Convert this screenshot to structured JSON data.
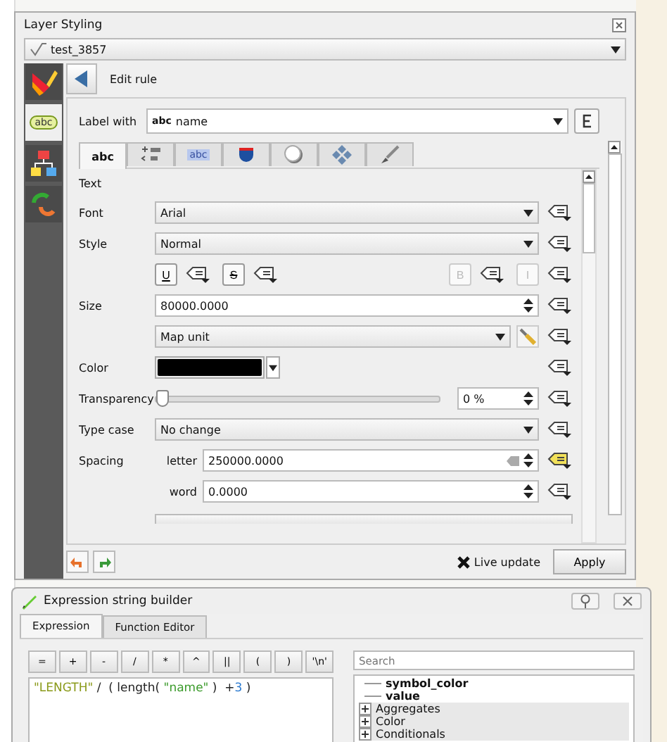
{
  "layer_styling": {
    "title": "Layer Styling",
    "layer": "test_3857",
    "edit_rule": "Edit rule",
    "sidebar": [
      {
        "kind": "brush",
        "selected": false
      },
      {
        "kind": "label",
        "text": "abc",
        "selected": true
      },
      {
        "kind": "diagram",
        "selected": false
      },
      {
        "kind": "history",
        "selected": false
      }
    ],
    "label_with": {
      "label": "Label with",
      "badge": "abc",
      "value": "name"
    },
    "tabs": [
      {
        "kind": "text",
        "text": "abc",
        "selected": true
      },
      {
        "kind": "formatting",
        "selected": false
      },
      {
        "kind": "buffer",
        "text": "abc",
        "selected": false
      },
      {
        "kind": "background",
        "selected": false
      },
      {
        "kind": "shadow",
        "selected": false
      },
      {
        "kind": "placement",
        "selected": false
      },
      {
        "kind": "rendering",
        "selected": false
      }
    ],
    "section": "Text",
    "rows": [
      {
        "kind": "combo",
        "label": "Font",
        "value": "Arial",
        "override_active": false
      },
      {
        "kind": "combo",
        "label": "Style",
        "value": "Normal",
        "override_active": false
      },
      {
        "kind": "toggles",
        "buttons": [
          {
            "text": "U",
            "override_active": false,
            "disabled": false
          },
          {
            "text": "S",
            "override_active": false,
            "disabled": false
          },
          {
            "text": "B",
            "override_active": false,
            "disabled": true
          },
          {
            "text": "I",
            "override_active": false,
            "disabled": true
          }
        ]
      },
      {
        "kind": "spin",
        "label": "Size",
        "value": "80000.0000",
        "override_active": false
      },
      {
        "kind": "unit",
        "value": "Map unit",
        "override_active": false
      },
      {
        "kind": "color",
        "label": "Color",
        "color": "#000000",
        "override_active": false
      },
      {
        "kind": "slider",
        "label": "Transparency",
        "level": 0,
        "reading": "0 %",
        "override_active": false
      },
      {
        "kind": "combo",
        "label": "Type case",
        "value": "No change",
        "override_active": false
      },
      {
        "kind": "spin",
        "label": "Spacing",
        "sublabel": "letter",
        "value": "250000.0000",
        "override_active": true
      },
      {
        "kind": "spin",
        "sublabel": "word",
        "value": "0.0000",
        "override_active": false
      }
    ],
    "live_update": {
      "label": "Live update",
      "checked": true
    },
    "apply": "Apply"
  },
  "expression_builder": {
    "title": "Expression string builder",
    "tabs": [
      {
        "label": "Expression",
        "selected": true
      },
      {
        "label": "Function Editor",
        "selected": false
      }
    ],
    "operators": [
      "=",
      "+",
      "-",
      "/",
      "*",
      "^",
      "||",
      "(",
      ")",
      "'\\n'"
    ],
    "expression": [
      {
        "kind": "field",
        "text": "\"LENGTH\""
      },
      {
        "kind": "op",
        "text": " /  ( "
      },
      {
        "kind": "func",
        "text": "length( "
      },
      {
        "kind": "string",
        "text": "\"name\""
      },
      {
        "kind": "op",
        "text": " )  +"
      },
      {
        "kind": "number",
        "text": "3"
      },
      {
        "kind": "op",
        "text": " )"
      }
    ],
    "search": {
      "placeholder": "Search"
    },
    "tree": [
      {
        "label": "symbol_color",
        "kind": "field"
      },
      {
        "label": "value",
        "kind": "field"
      },
      {
        "label": "Aggregates",
        "kind": "group",
        "expanded": false
      },
      {
        "label": "Color",
        "kind": "group",
        "expanded": false
      },
      {
        "label": "Conditionals",
        "kind": "group",
        "expanded": false
      }
    ]
  }
}
